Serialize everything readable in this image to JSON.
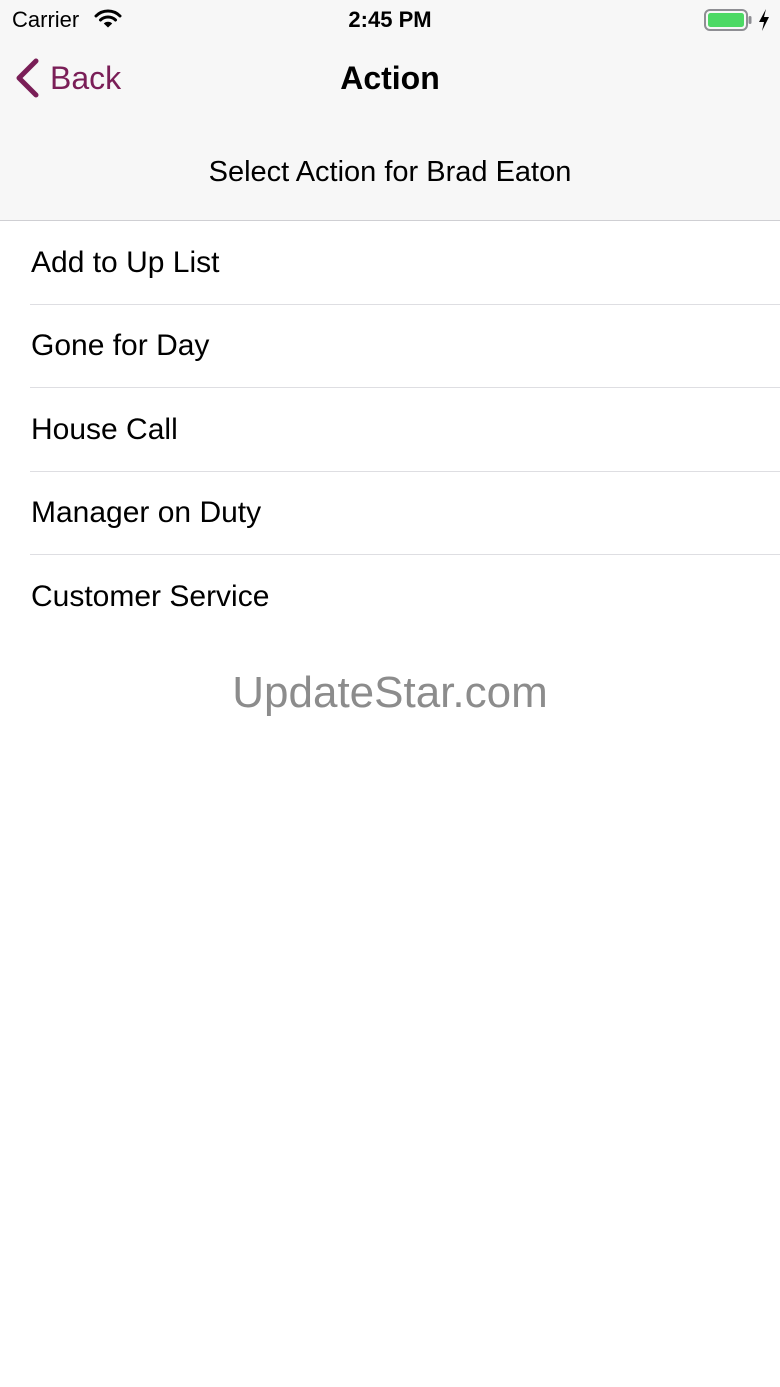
{
  "status_bar": {
    "carrier": "Carrier",
    "time": "2:45 PM",
    "battery_color": "#4cd964",
    "icons": [
      "wifi-icon",
      "battery-icon",
      "charging-bolt-icon"
    ]
  },
  "nav_bar": {
    "back_label": "Back",
    "back_icon": "chevron-left-icon",
    "title": "Action",
    "accent_color": "#7a1e57"
  },
  "section_header": "Select Action for Brad Eaton",
  "actions": [
    {
      "label": "Add to Up List"
    },
    {
      "label": "Gone for Day"
    },
    {
      "label": "House Call"
    },
    {
      "label": "Manager on Duty"
    },
    {
      "label": "Customer Service"
    }
  ],
  "watermark": "UpdateStar.com"
}
